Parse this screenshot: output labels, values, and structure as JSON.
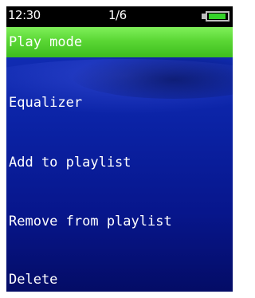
{
  "status": {
    "time": "12:30",
    "page": "1/6",
    "battery_level": 0.95
  },
  "menu": {
    "items": [
      {
        "label": "Play mode",
        "selected": true
      },
      {
        "label": "Equalizer",
        "selected": false
      },
      {
        "label": "Add to playlist",
        "selected": false
      },
      {
        "label": "Remove from playlist",
        "selected": false
      },
      {
        "label": "Delete",
        "selected": false
      }
    ]
  },
  "colors": {
    "highlight": "#5bd735",
    "background": "#0b23a6",
    "battery": "#35d22a"
  }
}
